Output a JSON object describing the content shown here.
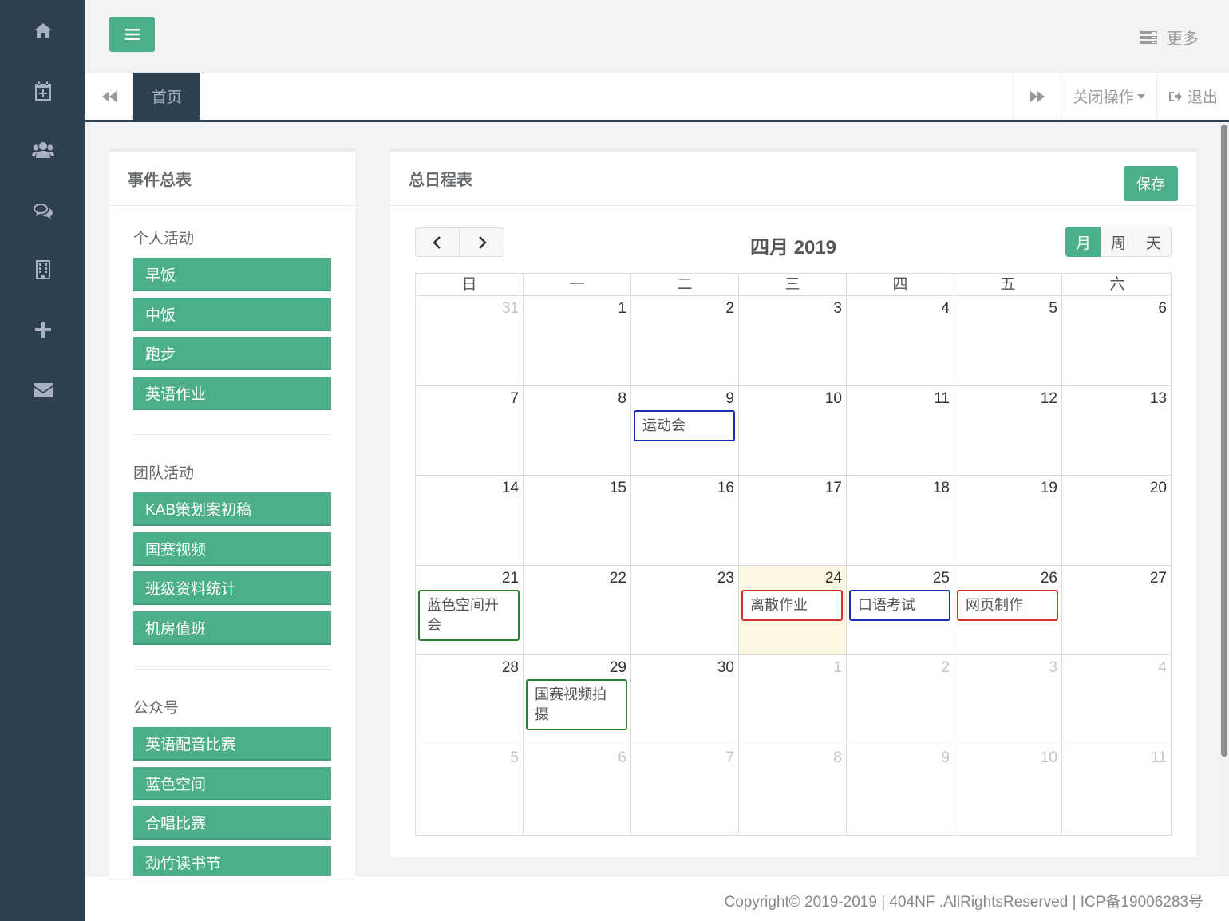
{
  "sidebar": {
    "icons": [
      "home-icon",
      "calendar-plus-icon",
      "users-icon",
      "comments-icon",
      "building-icon",
      "plus-icon",
      "envelope-icon"
    ]
  },
  "topbar": {
    "more_label": "更多"
  },
  "tabs": {
    "home_label": "首页",
    "close_ops_label": "关闭操作",
    "logout_label": "退出"
  },
  "events_panel": {
    "title": "事件总表",
    "sections": [
      {
        "title": "个人活动",
        "items": [
          "早饭",
          "中饭",
          "跑步",
          "英语作业"
        ]
      },
      {
        "title": "团队活动",
        "items": [
          "KAB策划案初稿",
          "国赛视频",
          "班级资料统计",
          "机房值班"
        ]
      },
      {
        "title": "公众号",
        "items": [
          "英语配音比赛",
          "蓝色空间",
          "合唱比赛",
          "劲竹读书节"
        ]
      }
    ]
  },
  "calendar": {
    "panel_title": "总日程表",
    "save_label": "保存",
    "month_title": "四月 2019",
    "views": [
      "月",
      "周",
      "天"
    ],
    "active_view": "月",
    "weekdays": [
      "日",
      "一",
      "二",
      "三",
      "四",
      "五",
      "六"
    ],
    "weeks": [
      [
        "31",
        "1",
        "2",
        "3",
        "4",
        "5",
        "6"
      ],
      [
        "7",
        "8",
        "9",
        "10",
        "11",
        "12",
        "13"
      ],
      [
        "14",
        "15",
        "16",
        "17",
        "18",
        "19",
        "20"
      ],
      [
        "21",
        "22",
        "23",
        "24",
        "25",
        "26",
        "27"
      ],
      [
        "28",
        "29",
        "30",
        "1",
        "2",
        "3",
        "4"
      ],
      [
        "5",
        "6",
        "7",
        "8",
        "9",
        "10",
        "11"
      ]
    ],
    "today": "24",
    "events": [
      {
        "title": "运动会",
        "week": 1,
        "day": 2,
        "color": "#1a2fb0"
      },
      {
        "title": "蓝色空间开会",
        "week": 3,
        "day": 0,
        "color": "#2e7d32"
      },
      {
        "title": "离散作业",
        "week": 3,
        "day": 3,
        "color": "#d32f2f"
      },
      {
        "title": "口语考试",
        "week": 3,
        "day": 4,
        "color": "#1a2fb0"
      },
      {
        "title": "网页制作",
        "week": 3,
        "day": 5,
        "color": "#d32f2f"
      },
      {
        "title": "国赛视频拍摄",
        "week": 4,
        "day": 1,
        "color": "#2e7d32"
      }
    ]
  },
  "footer": {
    "copyright": "Copyright© 2019-2019 | 404NF .AllRightsReserved | ICP备19006283号"
  },
  "colors": {
    "sidebar": "#2f4050",
    "accent": "#4caf8a"
  }
}
